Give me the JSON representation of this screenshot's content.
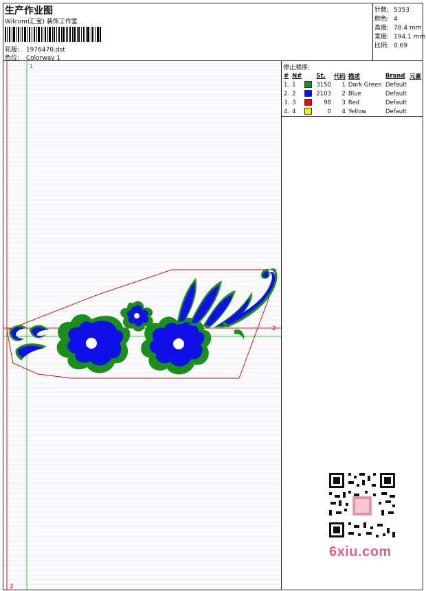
{
  "header": {
    "title": "生产作业图",
    "company": "Wilcom(汇宝) 装饰工作室",
    "design_label": "花版:",
    "design_value": "1976470.dst",
    "colorway_label": "色位:",
    "colorway_value": "Colorway 1"
  },
  "stats": [
    {
      "label": "针数:",
      "value": "5353"
    },
    {
      "label": "颜色:",
      "value": "4"
    },
    {
      "label": "高度:",
      "value": "78.4 mm"
    },
    {
      "label": "宽度:",
      "value": "194.1 mm"
    },
    {
      "label": "比例:",
      "value": "0.69"
    }
  ],
  "stop_sequence": {
    "title": "停止顺序:",
    "columns": [
      "#",
      "N#",
      "St.",
      "代码",
      "描述",
      "Brand",
      "元素"
    ],
    "rows": [
      {
        "idx": "1.",
        "n": "1",
        "color": "#1a8f1a",
        "st": "3150",
        "code": "1",
        "desc": "Dark Green",
        "brand": "Default"
      },
      {
        "idx": "2.",
        "n": "2",
        "color": "#1010e8",
        "st": "2103",
        "code": "2",
        "desc": "Blue",
        "brand": "Default"
      },
      {
        "idx": "3.",
        "n": "3",
        "color": "#e01010",
        "st": "98",
        "code": "3",
        "desc": "Red",
        "brand": "Default"
      },
      {
        "idx": "4.",
        "n": "4",
        "color": "#f0f000",
        "st": "0",
        "code": "4",
        "desc": "Yellow",
        "brand": "Default"
      }
    ]
  },
  "canvas": {
    "guide_top_label": "1",
    "guide_right_label": "2",
    "guide_bottom_label": "2"
  },
  "watermark": {
    "text": "6xiu.com"
  },
  "colors": {
    "dark_green": "#1a8f1a",
    "blue": "#1010e8",
    "red": "#e01010",
    "guide_green": "#33cc33"
  }
}
